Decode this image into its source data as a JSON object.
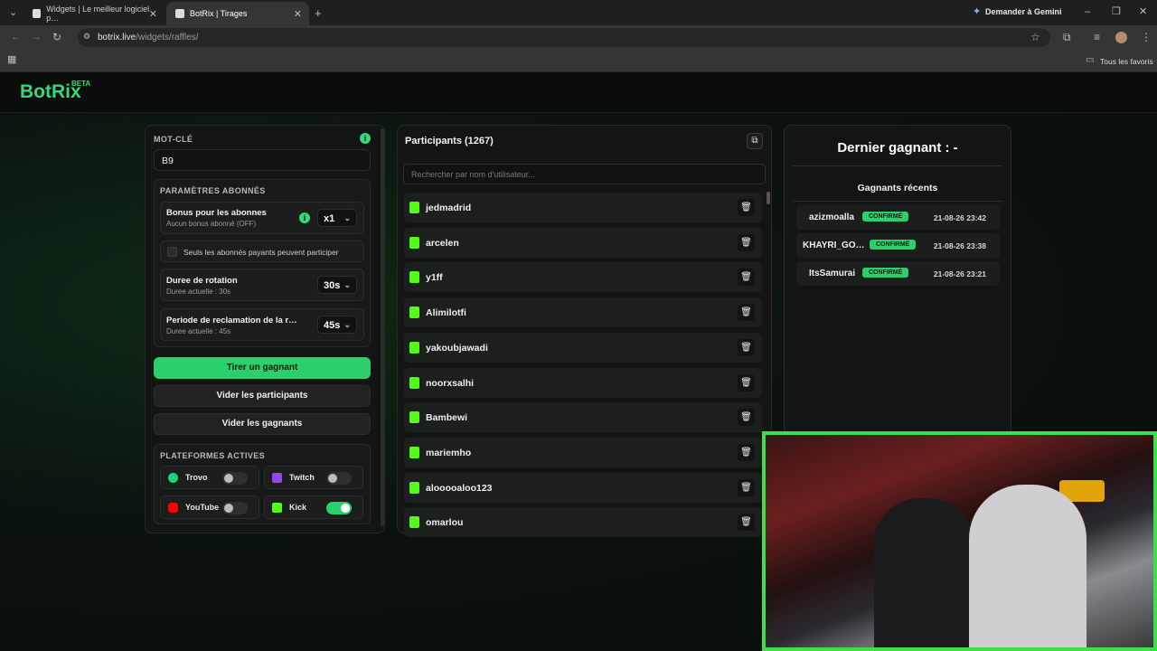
{
  "browser": {
    "tabs": [
      {
        "title": "Widgets | Le meilleur logiciel p…",
        "active": false
      },
      {
        "title": "BotRix | Tirages",
        "active": true
      }
    ],
    "gemini_label": "Demander à Gemini",
    "url_host": "botrix.live",
    "url_path": "/widgets/raffles/",
    "bookmarks_label": "Tous les favoris"
  },
  "app": {
    "logo": "BotRix",
    "beta": "BETA",
    "accent": "#33d97a"
  },
  "settings": {
    "keyword_label": "MOT-CLÉ",
    "keyword_value": "B9",
    "subs_label": "PARAMÈTRES ABONNÉS",
    "bonus_title": "Bonus pour les abonnes",
    "bonus_sub": "Aucun bonus abonné (OFF)",
    "bonus_value": "x1",
    "subs_only_label": "Seuls les abonnés payants peuvent participer",
    "rotation_title": "Duree de rotation",
    "rotation_sub": "Duree actuelle : 30s",
    "rotation_value": "30s",
    "claim_title": "Periode de reclamation de la r…",
    "claim_sub": "Duree actuelle : 45s",
    "claim_value": "45s"
  },
  "actions": {
    "draw": "Tirer un gagnant",
    "clear_participants": "Vider les participants",
    "clear_winners": "Vider les gagnants"
  },
  "platforms": {
    "label": "PLATEFORMES ACTIVES",
    "items": [
      {
        "name": "Trovo",
        "on": false,
        "color": "#1fd17b"
      },
      {
        "name": "Twitch",
        "on": false,
        "color": "#9146ff"
      },
      {
        "name": "YouTube",
        "on": false,
        "color": "#ff0000"
      },
      {
        "name": "Kick",
        "on": true,
        "color": "#53fc18"
      }
    ]
  },
  "participants": {
    "title": "Participants (1267)",
    "search_placeholder": "Rechercher par nom d'utilisateur...",
    "list": [
      "jedmadrid",
      "arcelen",
      "y1ff",
      "Alimilotfi",
      "yakoubjawadi",
      "noorxsalhi",
      "Bambewi",
      "mariemho",
      "alooooaloo123",
      "omarlou"
    ]
  },
  "winners": {
    "last_winner": "Dernier gagnant : -",
    "recent_title": "Gagnants récents",
    "list": [
      {
        "name": "azizmoalla",
        "status": "CONFIRMÉ",
        "date": "21-08-26 23:42"
      },
      {
        "name": "KHAYRI_GO…",
        "status": "CONFIRMÉ",
        "date": "21-08-26 23:38"
      },
      {
        "name": "ItsSamurai",
        "status": "CONFIRMÉ",
        "date": "21-08-26 23:21"
      }
    ]
  }
}
